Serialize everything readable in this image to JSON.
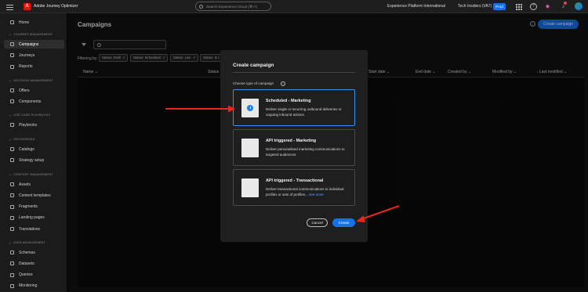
{
  "topbar": {
    "app_name": "Adobe Journey Optimizer",
    "search_placeholder": "Search Experience Cloud (⌘+/)",
    "org_name": "Experience Platform International",
    "sandbox_name": "Tech Insiders (VA7)",
    "prod_badge": "Prod",
    "logo_letter": "A"
  },
  "sidebar": {
    "top_items": [
      {
        "label": "Home",
        "icon": "home-icon"
      }
    ],
    "sections": [
      {
        "title": "JOURNEY MANAGEMENT",
        "items": [
          "Campaigns",
          "Journeys",
          "Reports"
        ]
      },
      {
        "title": "DECISION MANAGEMENT",
        "items": [
          "Offers",
          "Components"
        ]
      },
      {
        "title": "USE CASE PLAYBOOKS",
        "items": [
          "Playbooks"
        ]
      },
      {
        "title": "DECISIONING",
        "items": [
          "Catalogs",
          "Strategy setup"
        ]
      },
      {
        "title": "CONTENT MANAGEMENT",
        "items": [
          "Assets",
          "Content templates",
          "Fragments",
          "Landing pages",
          "Translations"
        ]
      },
      {
        "title": "DATA MANAGEMENT",
        "items": [
          "Schemas",
          "Datasets",
          "Queries",
          "Monitoring"
        ]
      }
    ],
    "active_item": "Campaigns"
  },
  "main": {
    "title": "Campaigns",
    "create_button": "Create campaign",
    "filtering_by": "Filtering by",
    "chips": [
      "Status: Draft",
      "Status: Scheduled",
      "Status: Live",
      "Status: In r"
    ],
    "columns": [
      "Name",
      "Status",
      "Start date",
      "End date",
      "Created by",
      "Modified by",
      "Last modified"
    ]
  },
  "modal": {
    "title": "Create campaign",
    "choose_label": "Choose type of campaign",
    "options": [
      {
        "title": "Scheduled - Marketing",
        "description": "Deliver single or recurring outbound deliveries or ongoing inbound actions.",
        "selected": true
      },
      {
        "title": "API triggered - Marketing",
        "description": "Deliver personalised marketing communications to targeted audiences.",
        "selected": false
      },
      {
        "title": "API triggered - Transactional",
        "description": "Deliver transactional communications to individual profiles or sets of profiles...",
        "see_more": "see more",
        "selected": false
      }
    ],
    "cancel": "Cancel",
    "create": "Create"
  },
  "colors": {
    "accent": "#1473e6",
    "selected_border": "#3a8ff5",
    "annotation_arrow": "#e8271c",
    "adobe_red": "#eb1000"
  }
}
